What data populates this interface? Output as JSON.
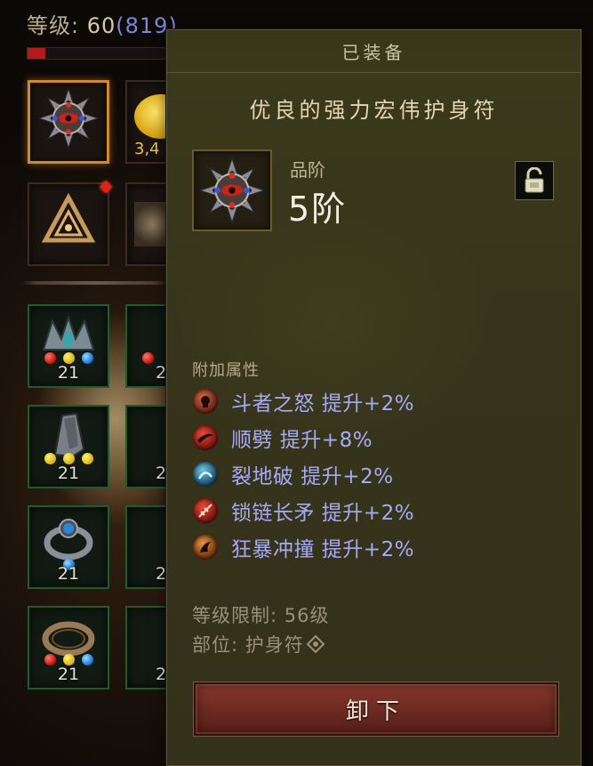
{
  "player": {
    "level_label": "等级: ",
    "level": "60",
    "paragon": "(819)",
    "xp_progress": 0.12
  },
  "inventory": {
    "slots": [
      {
        "name": "amulet-slot",
        "count": "",
        "selected": true
      },
      {
        "name": "gold-slot",
        "count": "3,4"
      },
      {
        "name": "rune-slot",
        "count": "",
        "new": true
      },
      {
        "name": "misc-slot",
        "count": ""
      },
      {
        "name": "helm-slot",
        "count": "21",
        "gems": [
          "r",
          "y",
          "b"
        ]
      },
      {
        "name": "bracer-slot",
        "count": "21",
        "gems": [
          "y",
          "y",
          "y"
        ]
      },
      {
        "name": "ring-slot",
        "count": "21",
        "gems": [
          "b"
        ]
      },
      {
        "name": "ring-slot-2",
        "count": "21",
        "gems": [
          "r",
          "y",
          "b"
        ]
      }
    ],
    "partial_counts": [
      "2",
      "2",
      "2",
      "2"
    ]
  },
  "tooltip": {
    "header": "已装备",
    "item_name": "优良的强力宏伟护身符",
    "tier_label": "品阶",
    "tier_value": "5阶",
    "attributes_title": "附加属性",
    "attributes": [
      {
        "icon": "fist-fury-icon",
        "text": "斗者之怒  提升+2%",
        "color": "#8a2a18"
      },
      {
        "icon": "cleave-icon",
        "text": "顺劈  提升+8%",
        "color": "#b0201a"
      },
      {
        "icon": "ground-stomp-icon",
        "text": "裂地破  提升+2%",
        "color": "#1c6a8a"
      },
      {
        "icon": "chain-spear-icon",
        "text": "锁链长矛  提升+2%",
        "color": "#b0201a"
      },
      {
        "icon": "frenzy-charge-icon",
        "text": "狂暴冲撞  提升+2%",
        "color": "#a24a14"
      }
    ],
    "level_req": "等级限制: 56级",
    "slot_label": "部位: 护身符",
    "unequip_label": "卸下"
  },
  "colors": {
    "panel_bg": "#3a381c",
    "attribute_text": "#a8a9f4",
    "unequip_button": "#7a3328",
    "selected_slot_border": "#d08a2e"
  }
}
